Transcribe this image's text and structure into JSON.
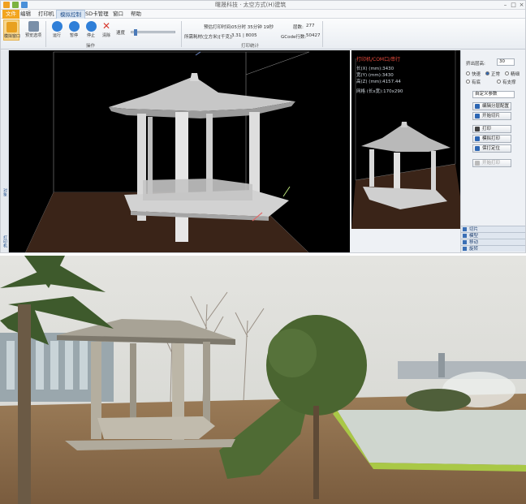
{
  "app": {
    "title": "曙晟科技 · 太空方式(H)建筑",
    "menu": [
      {
        "label": "文件",
        "state": "active"
      },
      {
        "label": "编辑",
        "state": "normal"
      },
      {
        "label": "打印机",
        "state": "normal"
      },
      {
        "label": "模拟控制",
        "state": "tab-active"
      },
      {
        "label": "SD卡管理",
        "state": "normal"
      },
      {
        "label": "窗口",
        "state": "normal"
      },
      {
        "label": "帮助",
        "state": "normal"
      }
    ],
    "ribbon": {
      "buttons": [
        {
          "label": "模拟窗口",
          "icon": "window-icon",
          "color": "#e8a020"
        },
        {
          "label": "预览选项",
          "icon": "options-icon",
          "color": "#7a8fa8"
        },
        {
          "label": "运行",
          "icon": "play-icon",
          "color": "#2f7fd8"
        },
        {
          "label": "暂停",
          "icon": "pause-icon",
          "color": "#2f7fd8"
        },
        {
          "label": "停止",
          "icon": "stop-icon",
          "color": "#2f7fd8"
        },
        {
          "label": "清除",
          "icon": "clear-icon",
          "color": "#d83a2f"
        }
      ],
      "speed_label": "速度",
      "operation_group": "操作",
      "stats_group": "打印统计",
      "stats": {
        "print_time_label": "预估打印时间:",
        "print_time_value": "05分时 35分钟 19秒",
        "volume_label": "所需耗材(立方米)[千克]:",
        "volume_value": "3.31 | 8005",
        "layers_label": "层数:",
        "layers_value": "277",
        "gcode_label": "GCode行数:",
        "gcode_value": "50427"
      }
    },
    "preview": {
      "title": "打印机/COM口/串行",
      "dims": [
        "长(X) (mm):3430",
        "宽(Y) (mm):3430",
        "高(Z) (mm):4157.44",
        "网格 (长x宽):170x290"
      ]
    },
    "left_tabs": [
      "对象",
      "打印机"
    ],
    "right_panel": {
      "layer_label": "挤出层高:",
      "layer_value": "30",
      "radios": [
        {
          "label": "快速",
          "on": false
        },
        {
          "label": "正常",
          "on": true
        },
        {
          "label": "精细",
          "on": false
        },
        {
          "label": "有底",
          "on": false
        },
        {
          "label": "有支撑",
          "on": false
        }
      ],
      "profile_value": "自定义参数",
      "buttons": [
        {
          "label": "编辑分层配置",
          "color": "#2d66b3",
          "enabled": true
        },
        {
          "label": "开始切片",
          "color": "#2d66b3",
          "enabled": true
        },
        {
          "label": "打印",
          "color": "#444",
          "enabled": true
        },
        {
          "label": "模拟打印",
          "color": "#2d66b3",
          "enabled": true
        },
        {
          "label": "保打定位",
          "color": "#2d66b3",
          "enabled": true
        },
        {
          "label": "开始打印",
          "color": "#999",
          "enabled": false
        }
      ],
      "tabs": [
        "切片",
        "模型",
        "移动",
        "旋转"
      ]
    }
  },
  "photo": {
    "colors": {
      "sky": "#dcdcd7",
      "ground": "#8a6b4a",
      "grass": "#4f6b34",
      "pavilion": "#a8a396",
      "water": "#cfd6cf",
      "pool_rim": "#a9c846"
    }
  }
}
